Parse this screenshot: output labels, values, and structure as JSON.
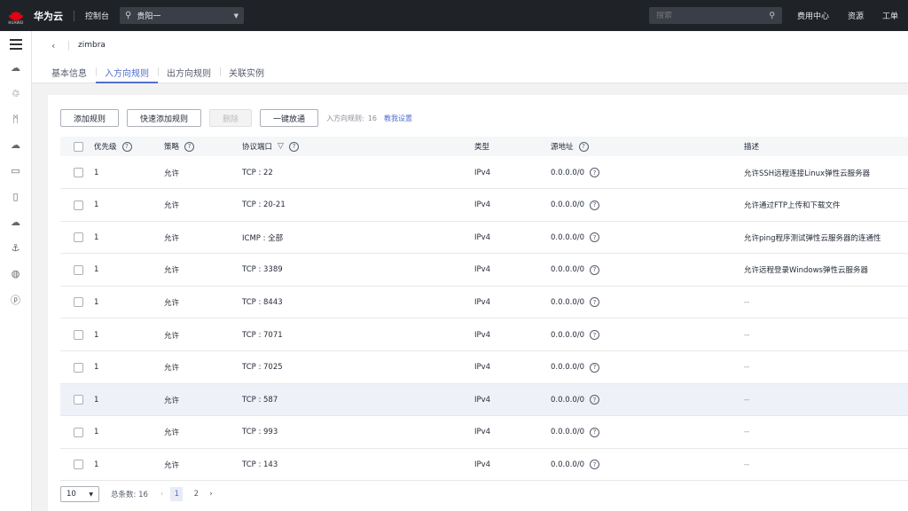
{
  "topbar": {
    "logo_sub": "HUAWEI",
    "brand": "华为云",
    "console": "控制台",
    "region": "贵阳一",
    "search_placeholder": "搜索",
    "links": [
      "费用中心",
      "资源",
      "工单"
    ]
  },
  "sidebar": {
    "icons": [
      "cloud-server-icon",
      "cluster-icon",
      "bandwidth-icon",
      "storage-icon",
      "database-icon",
      "document-icon",
      "cloud-icon",
      "anchor-icon",
      "globe-icon",
      "coupon-icon"
    ]
  },
  "header": {
    "title": "zimbra",
    "tabs": [
      "基本信息",
      "入方向规则",
      "出方向规则",
      "关联实例"
    ],
    "active_tab": 1
  },
  "toolbar": {
    "add_rule": "添加规则",
    "quick_add": "快速添加规则",
    "delete": "删除",
    "one_click": "一键放通",
    "rule_count_label": "入方向规则:",
    "rule_count": "16",
    "help_link": "教我设置"
  },
  "table": {
    "headers": {
      "priority": "优先级",
      "policy": "策略",
      "protocol_port": "协议端口",
      "type": "类型",
      "source": "源地址",
      "description": "描述"
    },
    "rows": [
      {
        "priority": "1",
        "policy": "允许",
        "port": "TCP : 22",
        "type": "IPv4",
        "source": "0.0.0.0/0",
        "desc": "允许SSH远程连接Linux弹性云服务器"
      },
      {
        "priority": "1",
        "policy": "允许",
        "port": "TCP : 20-21",
        "type": "IPv4",
        "source": "0.0.0.0/0",
        "desc": "允许通过FTP上传和下载文件"
      },
      {
        "priority": "1",
        "policy": "允许",
        "port": "ICMP : 全部",
        "type": "IPv4",
        "source": "0.0.0.0/0",
        "desc": "允许ping程序测试弹性云服务器的连通性"
      },
      {
        "priority": "1",
        "policy": "允许",
        "port": "TCP : 3389",
        "type": "IPv4",
        "source": "0.0.0.0/0",
        "desc": "允许远程登录Windows弹性云服务器"
      },
      {
        "priority": "1",
        "policy": "允许",
        "port": "TCP : 8443",
        "type": "IPv4",
        "source": "0.0.0.0/0",
        "desc": "--"
      },
      {
        "priority": "1",
        "policy": "允许",
        "port": "TCP : 7071",
        "type": "IPv4",
        "source": "0.0.0.0/0",
        "desc": "--"
      },
      {
        "priority": "1",
        "policy": "允许",
        "port": "TCP : 7025",
        "type": "IPv4",
        "source": "0.0.0.0/0",
        "desc": "--"
      },
      {
        "priority": "1",
        "policy": "允许",
        "port": "TCP : 587",
        "type": "IPv4",
        "source": "0.0.0.0/0",
        "desc": "--"
      },
      {
        "priority": "1",
        "policy": "允许",
        "port": "TCP : 993",
        "type": "IPv4",
        "source": "0.0.0.0/0",
        "desc": "--"
      },
      {
        "priority": "1",
        "policy": "允许",
        "port": "TCP : 143",
        "type": "IPv4",
        "source": "0.0.0.0/0",
        "desc": "--"
      }
    ],
    "highlighted_row": 7
  },
  "pager": {
    "page_size": "10",
    "total_label": "总条数: 16",
    "pages": [
      "1",
      "2"
    ],
    "current_page": "1"
  },
  "colors": {
    "topbar_bg": "#1f2328",
    "accent": "#526ecc",
    "logo_red": "#e60012"
  }
}
